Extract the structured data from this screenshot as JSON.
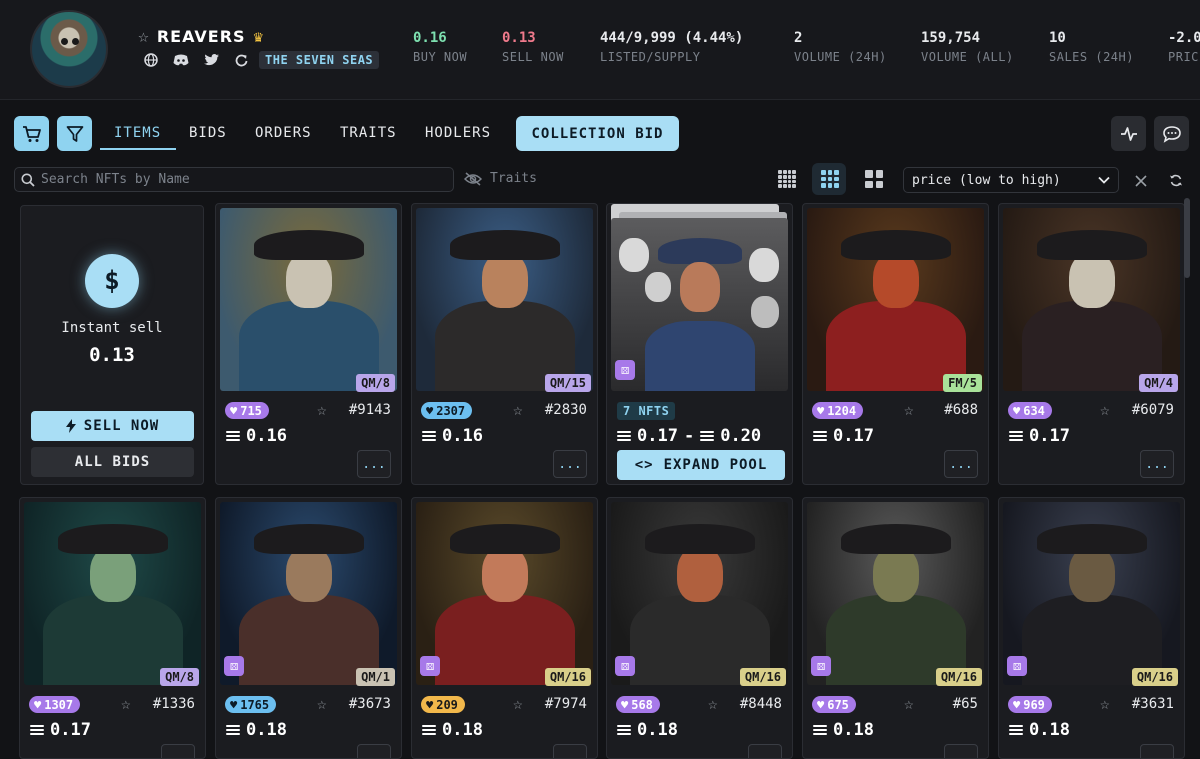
{
  "collection": {
    "name": "REAVERS",
    "tag": "THE SEVEN SEAS"
  },
  "stats": [
    {
      "value": "0.16",
      "label": "BUY NOW",
      "color": "#7ee0b0"
    },
    {
      "value": "0.13",
      "label": "SELL NOW",
      "color": "#f07a8c"
    },
    {
      "value": "444/9,999 (4.44%)",
      "label": "LISTED/SUPPLY",
      "color": "#e8eaed"
    },
    {
      "value": "2",
      "label": "VOLUME (24H)",
      "color": "#e8eaed"
    },
    {
      "value": "159,754",
      "label": "VOLUME (ALL)",
      "color": "#e8eaed"
    },
    {
      "value": "10",
      "label": "SALES (24H)",
      "color": "#e8eaed"
    },
    {
      "value": "-2.0",
      "label": "PRIC",
      "color": "#e8eaed"
    }
  ],
  "tabs": [
    "ITEMS",
    "BIDS",
    "ORDERS",
    "TRAITS",
    "HODLERS"
  ],
  "collection_bid_label": "COLLECTION BID",
  "search": {
    "placeholder": "Search NFTs by Name"
  },
  "traits_label": "Traits",
  "sort": {
    "selected": "price (low to high)"
  },
  "instant_sell": {
    "label": "Instant sell",
    "value": "0.13",
    "sell_now": "SELL NOW",
    "all_bids": "ALL BIDS"
  },
  "pool": {
    "count": "7 NFTS",
    "price_low": "0.17",
    "price_high": "0.20",
    "sep": "-",
    "expand": "EXPAND POOL"
  },
  "more_label": "...",
  "cards": [
    {
      "likes": "715",
      "like_style": "purple",
      "id": "#9143",
      "price": "0.16",
      "badge": "QM/8",
      "badge_color": "#b9a6ea",
      "dice": false,
      "palette": [
        "#7a6a3a",
        "#3d5a6e",
        "#c9c2b2",
        "#2a4f6b"
      ]
    },
    {
      "likes": "2307",
      "like_style": "blue",
      "id": "#2830",
      "price": "0.16",
      "badge": "QM/15",
      "badge_color": "#b9a6ea",
      "dice": false,
      "palette": [
        "#3b5e86",
        "#1e2a3a",
        "#b9825d",
        "#2c2a2a"
      ]
    },
    {
      "likes": "1204",
      "like_style": "purple",
      "id": "#688",
      "price": "0.17",
      "badge": "FM/5",
      "badge_color": "#a9e29a",
      "dice": false,
      "palette": [
        "#5a3a1d",
        "#2a1a12",
        "#b54a2a",
        "#8d1f1f"
      ]
    },
    {
      "likes": "634",
      "like_style": "purple",
      "id": "#6079",
      "price": "0.17",
      "badge": "QM/4",
      "badge_color": "#b9a6ea",
      "dice": false,
      "palette": [
        "#4a3526",
        "#241a14",
        "#c9c2b2",
        "#2a2022"
      ]
    },
    {
      "likes": "1307",
      "like_style": "purple",
      "id": "#1336",
      "price": "0.17",
      "badge": "QM/8",
      "badge_color": "#b9a6ea",
      "dice": false,
      "palette": [
        "#1f4a48",
        "#0f2426",
        "#7aa07a",
        "#1d3a36"
      ]
    },
    {
      "likes": "1765",
      "like_style": "blue",
      "id": "#3673",
      "price": "0.18",
      "badge": "QM/1",
      "badge_color": "#c9c2b2",
      "dice": true,
      "palette": [
        "#2b4a6e",
        "#0f1a2a",
        "#9a7a5d",
        "#4a2f2a"
      ]
    },
    {
      "likes": "209",
      "like_style": "gold",
      "id": "#7974",
      "price": "0.18",
      "badge": "QM/16",
      "badge_color": "#d9cf8a",
      "dice": true,
      "palette": [
        "#5a4a2a",
        "#2a2014",
        "#c27a5a",
        "#7a1f1f"
      ]
    },
    {
      "likes": "568",
      "like_style": "purple",
      "id": "#8448",
      "price": "0.18",
      "badge": "QM/16",
      "badge_color": "#d9cf8a",
      "dice": true,
      "palette": [
        "#3a3a3a",
        "#1a1a1a",
        "#b0603e",
        "#2a2a2a"
      ]
    },
    {
      "likes": "675",
      "like_style": "purple",
      "id": "#65",
      "price": "0.18",
      "badge": "QM/16",
      "badge_color": "#d9cf8a",
      "dice": true,
      "palette": [
        "#5a5a5a",
        "#222222",
        "#7a7a52",
        "#2e3a2a"
      ]
    },
    {
      "likes": "969",
      "like_style": "purple",
      "id": "#3631",
      "price": "0.18",
      "badge": "QM/16",
      "badge_color": "#d9cf8a",
      "dice": true,
      "palette": [
        "#3a4050",
        "#161820",
        "#6a5a42",
        "#1e1e22"
      ]
    }
  ]
}
